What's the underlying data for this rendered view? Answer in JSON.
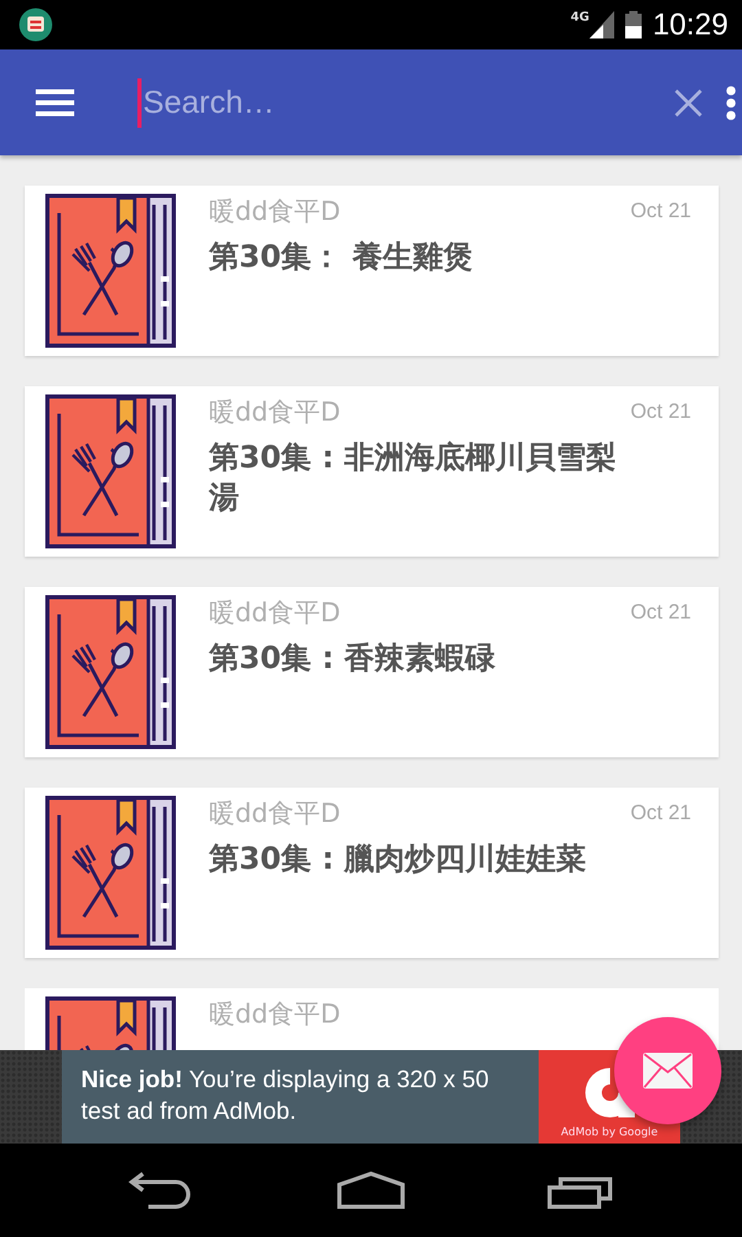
{
  "status_bar": {
    "network": "4G",
    "time": "10:29"
  },
  "app_bar": {
    "search": {
      "placeholder": "Search…"
    }
  },
  "cards": [
    {
      "source": "暖dd食平D",
      "date": "Oct 21",
      "title": "第30集： 養生雞煲"
    },
    {
      "source": "暖dd食平D",
      "date": "Oct 21",
      "title": "第30集 : 非洲海底椰川貝雪梨湯"
    },
    {
      "source": "暖dd食平D",
      "date": "Oct 21",
      "title": "第30集 : 香辣素蝦碌"
    },
    {
      "source": "暖dd食平D",
      "date": "Oct 21",
      "title": "第30集 : 臘肉炒四川娃娃菜"
    },
    {
      "source": "暖dd食平D"
    }
  ],
  "ad": {
    "text": "**Nice job!** You’re displaying a 320 x 50 test ad from AdMob.",
    "brand": "AdMob by Google"
  }
}
